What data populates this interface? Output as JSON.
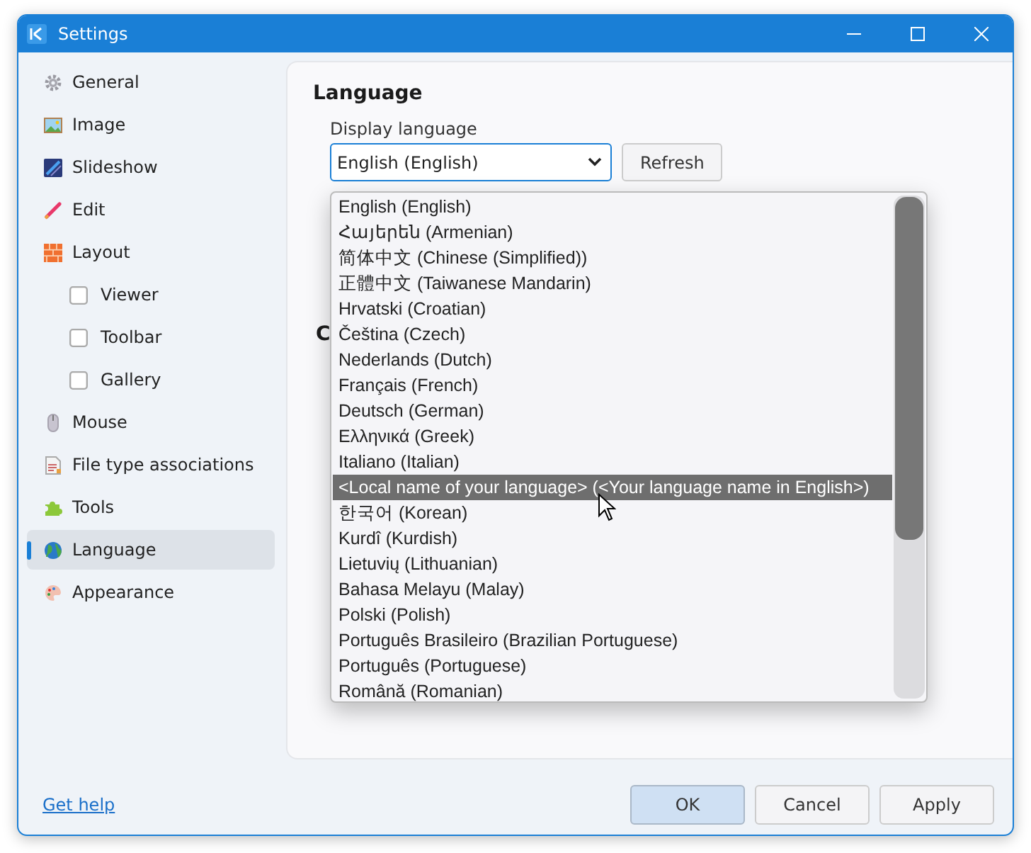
{
  "window": {
    "title": "Settings"
  },
  "sidebar": {
    "items": [
      {
        "label": "General",
        "selected": false
      },
      {
        "label": "Image",
        "selected": false
      },
      {
        "label": "Slideshow",
        "selected": false
      },
      {
        "label": "Edit",
        "selected": false
      },
      {
        "label": "Layout",
        "selected": false,
        "children": [
          {
            "label": "Viewer",
            "selected": false
          },
          {
            "label": "Toolbar",
            "selected": false
          },
          {
            "label": "Gallery",
            "selected": false
          }
        ]
      },
      {
        "label": "Mouse",
        "selected": false
      },
      {
        "label": "File type associations",
        "selected": false
      },
      {
        "label": "Tools",
        "selected": false
      },
      {
        "label": "Language",
        "selected": true
      },
      {
        "label": "Appearance",
        "selected": false
      }
    ]
  },
  "content": {
    "heading": "Language",
    "field_label": "Display language",
    "select": {
      "value": "English (English)"
    },
    "refresh_button": "Refresh",
    "heading_2": "C"
  },
  "dropdown": {
    "options": [
      {
        "label": "English (English)",
        "selected": false
      },
      {
        "label": "Հայերեն (Armenian)",
        "selected": false
      },
      {
        "label": "简体中文 (Chinese (Simplified))",
        "selected": false
      },
      {
        "label": "正體中文 (Taiwanese Mandarin)",
        "selected": false
      },
      {
        "label": "Hrvatski (Croatian)",
        "selected": false
      },
      {
        "label": "Čeština (Czech)",
        "selected": false
      },
      {
        "label": "Nederlands (Dutch)",
        "selected": false
      },
      {
        "label": "Français (French)",
        "selected": false
      },
      {
        "label": "Deutsch (German)",
        "selected": false
      },
      {
        "label": "Ελληνικά (Greek)",
        "selected": false
      },
      {
        "label": "Italiano (Italian)",
        "selected": false
      },
      {
        "label": "<Local name of your language> (<Your language name in English>)",
        "selected": true
      },
      {
        "label": "한국어 (Korean)",
        "selected": false
      },
      {
        "label": "Kurdî (Kurdish)",
        "selected": false
      },
      {
        "label": "Lietuvių (Lithuanian)",
        "selected": false
      },
      {
        "label": "Bahasa Melayu (Malay)",
        "selected": false
      },
      {
        "label": "Polski (Polish)",
        "selected": false
      },
      {
        "label": "Português Brasileiro (Brazilian Portuguese)",
        "selected": false
      },
      {
        "label": "Português (Portuguese)",
        "selected": false
      },
      {
        "label": "Română (Romanian)",
        "selected": false
      }
    ]
  },
  "footer": {
    "help_link": "Get help",
    "buttons": [
      {
        "label": "OK",
        "default": true
      },
      {
        "label": "Cancel",
        "default": false
      },
      {
        "label": "Apply",
        "default": false
      }
    ]
  }
}
